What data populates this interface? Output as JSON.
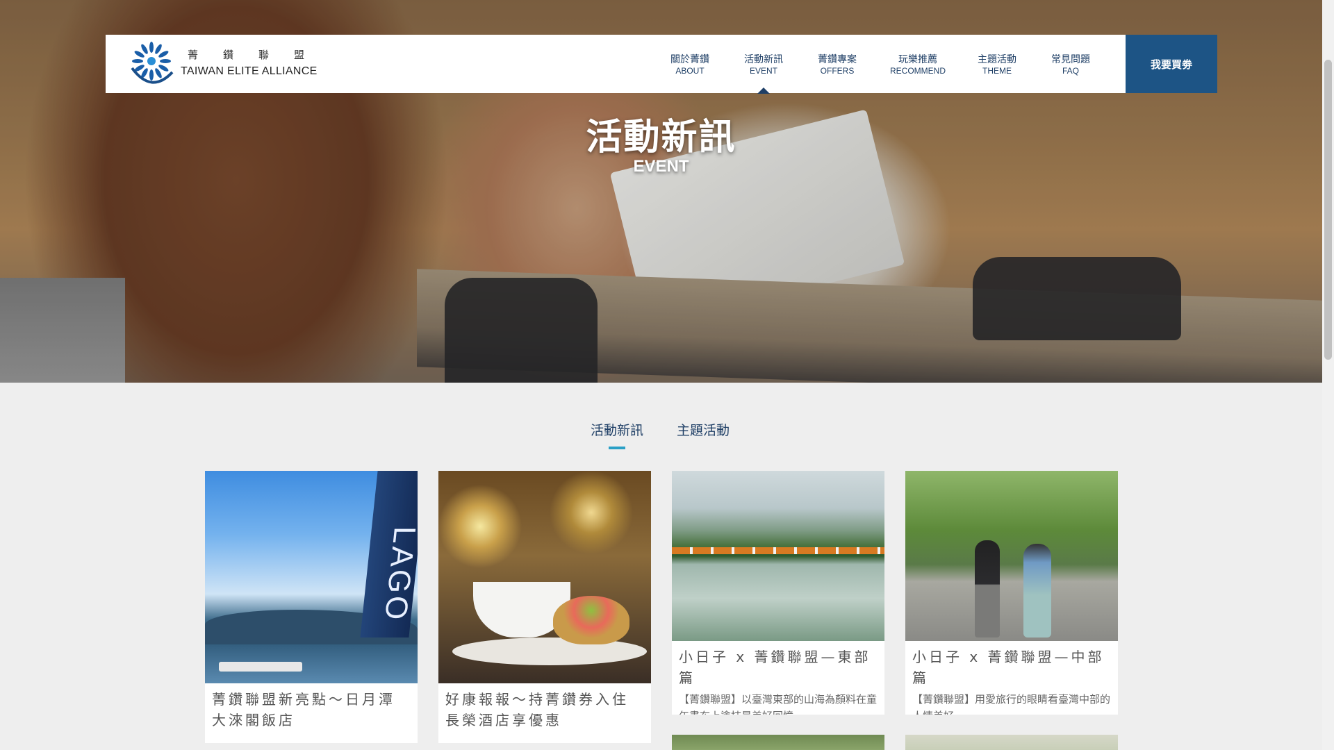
{
  "header": {
    "brand_cn": "菁鑽聯盟",
    "brand_en": "TAIWAN ELITE ALLIANCE",
    "nav": [
      {
        "cn": "關於菁鑽",
        "en": "ABOUT"
      },
      {
        "cn": "活動新訊",
        "en": "EVENT"
      },
      {
        "cn": "菁鑽專案",
        "en": "OFFERS"
      },
      {
        "cn": "玩樂推薦",
        "en": "RECOMMEND"
      },
      {
        "cn": "主題活動",
        "en": "THEME"
      },
      {
        "cn": "常見問題",
        "en": "FAQ"
      }
    ],
    "active_nav": "EVENT",
    "buy_button": "我要買劵"
  },
  "hero": {
    "title": "活動新訊",
    "subtitle": "EVENT"
  },
  "tabs": {
    "items": [
      "活動新訊",
      "主題活動"
    ],
    "active": "活動新訊"
  },
  "cards": [
    {
      "title": "菁鑽聯盟新亮點～日月潭大淶閣飯店",
      "desc": "",
      "sign_text": "LAGO"
    },
    {
      "title": "好康報報～持菁鑽券入住長榮酒店享優惠",
      "desc": ""
    },
    {
      "title": "小日子 x 菁鑽聯盟—東部篇",
      "desc": "【菁鑽聯盟】以臺灣東部的山海為顏料在童年畫布上塗抹最美好回憶"
    },
    {
      "title": "小日子 x 菁鑽聯盟—中部篇",
      "desc": "【菁鑽聯盟】用愛旅行的眼睛看臺灣中部的人情美好"
    }
  ],
  "colors": {
    "nav_text": "#1f3f66",
    "buy_bg": "#1d5485",
    "tab_underline": "#2aa0c6",
    "page_bg": "#eeeeee"
  }
}
